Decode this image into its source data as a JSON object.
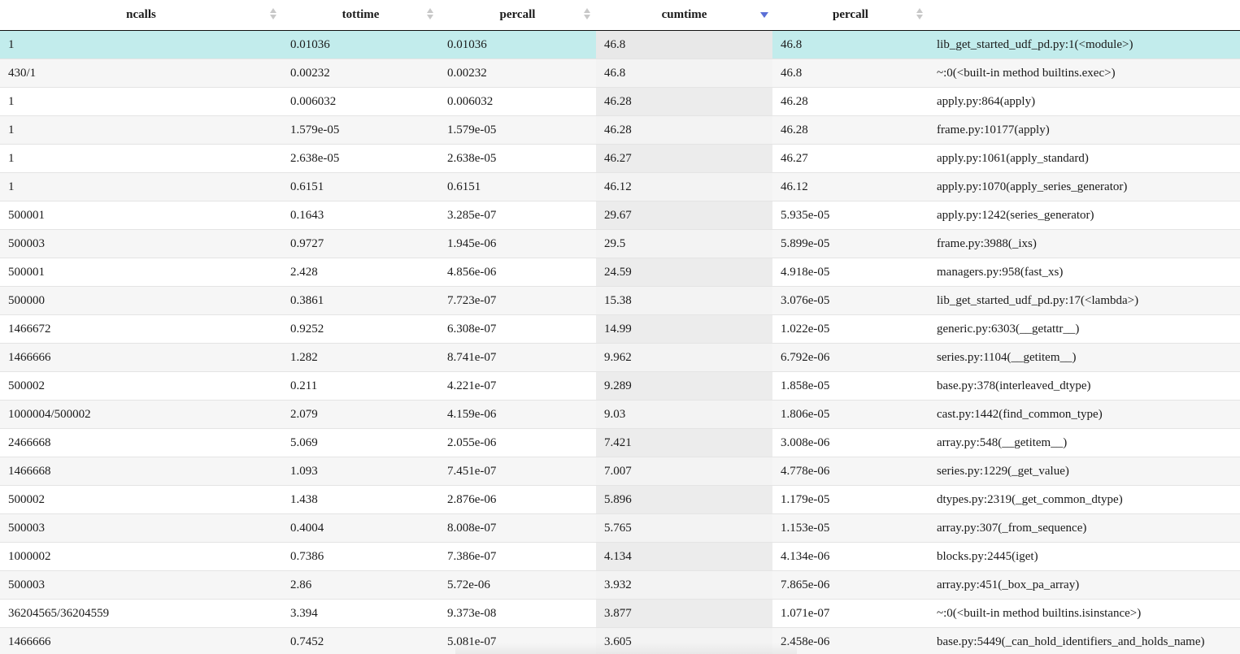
{
  "columns": [
    {
      "label": "ncalls",
      "sort": "none"
    },
    {
      "label": "tottime",
      "sort": "none"
    },
    {
      "label": "percall",
      "sort": "none"
    },
    {
      "label": "cumtime",
      "sort": "desc"
    },
    {
      "label": "percall",
      "sort": "none"
    },
    {
      "label": "",
      "sort": "hidden"
    }
  ],
  "sorted_column_index": 3,
  "selected_row_index": 0,
  "rows": [
    [
      "1",
      "0.01036",
      "0.01036",
      "46.8",
      "46.8",
      "lib_get_started_udf_pd.py:1(<module>)"
    ],
    [
      "430/1",
      "0.00232",
      "0.00232",
      "46.8",
      "46.8",
      "~:0(<built-in method builtins.exec>)"
    ],
    [
      "1",
      "0.006032",
      "0.006032",
      "46.28",
      "46.28",
      "apply.py:864(apply)"
    ],
    [
      "1",
      "1.579e-05",
      "1.579e-05",
      "46.28",
      "46.28",
      "frame.py:10177(apply)"
    ],
    [
      "1",
      "2.638e-05",
      "2.638e-05",
      "46.27",
      "46.27",
      "apply.py:1061(apply_standard)"
    ],
    [
      "1",
      "0.6151",
      "0.6151",
      "46.12",
      "46.12",
      "apply.py:1070(apply_series_generator)"
    ],
    [
      "500001",
      "0.1643",
      "3.285e-07",
      "29.67",
      "5.935e-05",
      "apply.py:1242(series_generator)"
    ],
    [
      "500003",
      "0.9727",
      "1.945e-06",
      "29.5",
      "5.899e-05",
      "frame.py:3988(_ixs)"
    ],
    [
      "500001",
      "2.428",
      "4.856e-06",
      "24.59",
      "4.918e-05",
      "managers.py:958(fast_xs)"
    ],
    [
      "500000",
      "0.3861",
      "7.723e-07",
      "15.38",
      "3.076e-05",
      "lib_get_started_udf_pd.py:17(<lambda>)"
    ],
    [
      "1466672",
      "0.9252",
      "6.308e-07",
      "14.99",
      "1.022e-05",
      "generic.py:6303(__getattr__)"
    ],
    [
      "1466666",
      "1.282",
      "8.741e-07",
      "9.962",
      "6.792e-06",
      "series.py:1104(__getitem__)"
    ],
    [
      "500002",
      "0.211",
      "4.221e-07",
      "9.289",
      "1.858e-05",
      "base.py:378(interleaved_dtype)"
    ],
    [
      "1000004/500002",
      "2.079",
      "4.159e-06",
      "9.03",
      "1.806e-05",
      "cast.py:1442(find_common_type)"
    ],
    [
      "2466668",
      "5.069",
      "2.055e-06",
      "7.421",
      "3.008e-06",
      "array.py:548(__getitem__)"
    ],
    [
      "1466668",
      "1.093",
      "7.451e-07",
      "7.007",
      "4.778e-06",
      "series.py:1229(_get_value)"
    ],
    [
      "500002",
      "1.438",
      "2.876e-06",
      "5.896",
      "1.179e-05",
      "dtypes.py:2319(_get_common_dtype)"
    ],
    [
      "500003",
      "0.4004",
      "8.008e-07",
      "5.765",
      "1.153e-05",
      "array.py:307(_from_sequence)"
    ],
    [
      "1000002",
      "0.7386",
      "7.386e-07",
      "4.134",
      "4.134e-06",
      "blocks.py:2445(iget)"
    ],
    [
      "500003",
      "2.86",
      "5.72e-06",
      "3.932",
      "7.865e-06",
      "array.py:451(_box_pa_array)"
    ],
    [
      "36204565/36204559",
      "3.394",
      "9.373e-08",
      "3.877",
      "1.071e-07",
      "~:0(<built-in method builtins.isinstance>)"
    ],
    [
      "1466666",
      "0.7452",
      "5.081e-07",
      "3.605",
      "2.458e-06",
      "base.py:5449(_can_hold_identifiers_and_holds_name)"
    ]
  ],
  "colors": {
    "selected_row": "#c2ecec",
    "sort_active": "#5b6fd6",
    "sort_inactive": "#c8c8c8"
  }
}
